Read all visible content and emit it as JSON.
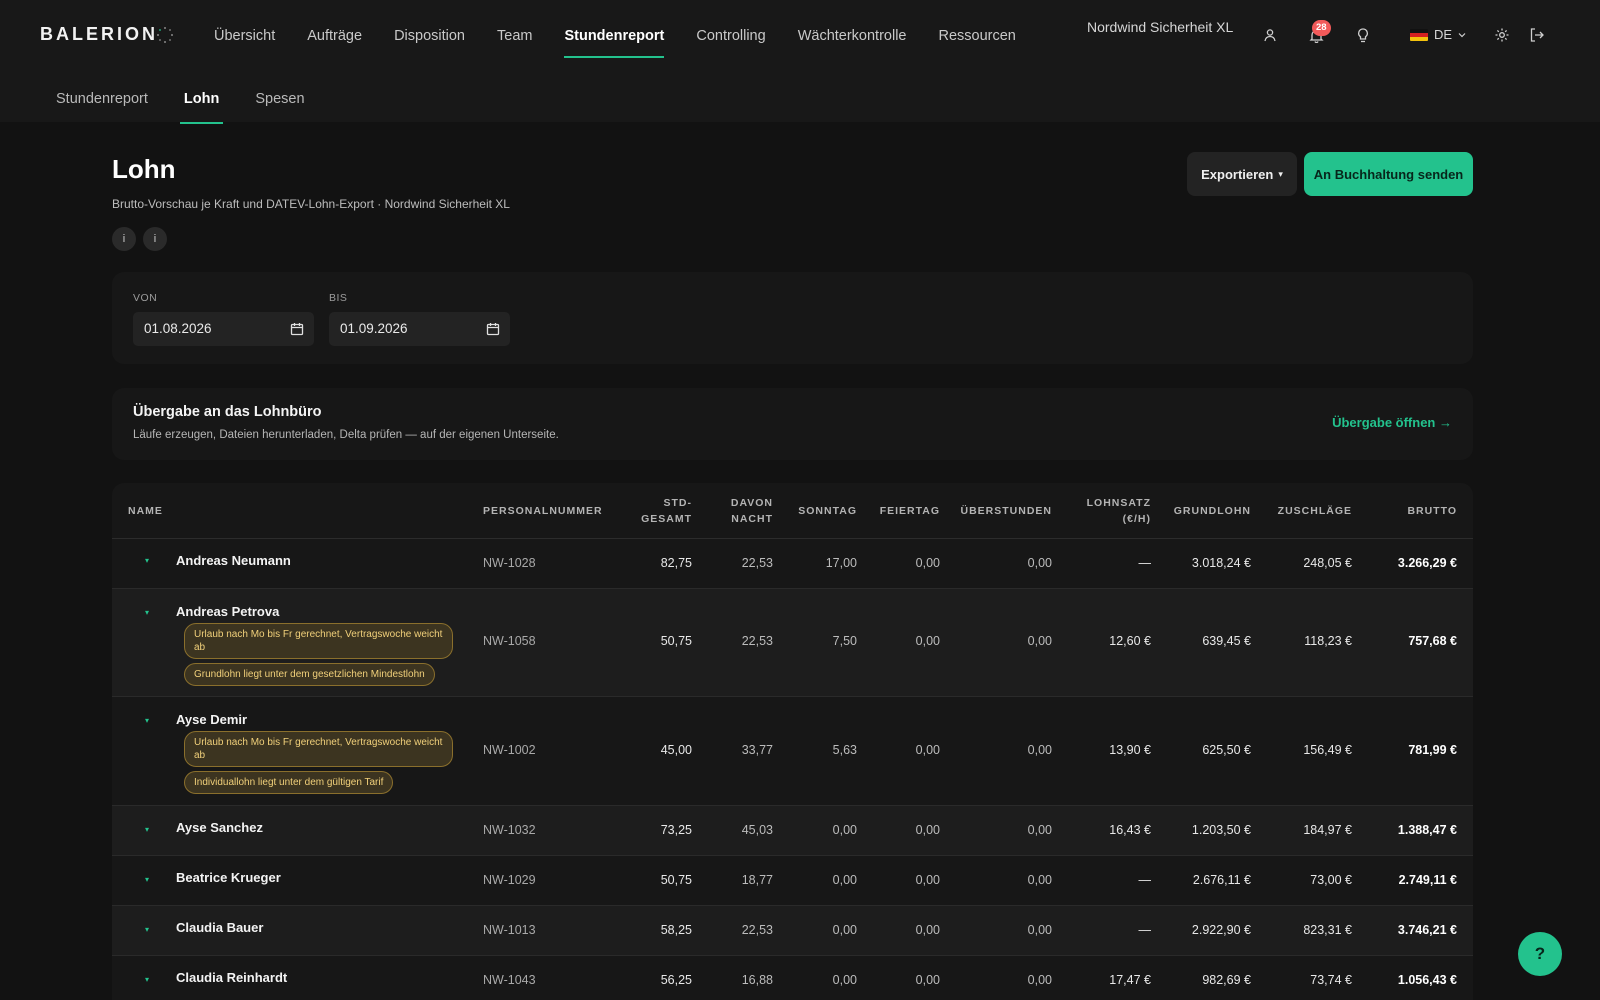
{
  "app": {
    "logo": "BALERION",
    "nav": [
      "Übersicht",
      "Aufträge",
      "Disposition",
      "Team",
      "Stundenreport",
      "Controlling",
      "Wächterkontrolle",
      "Ressourcen"
    ],
    "active_nav": "Stundenreport",
    "tenant": "Nordwind Sicherheit XL",
    "notification_count": "28",
    "language": "DE",
    "accent": "#23c28d"
  },
  "subnav": {
    "items": [
      "Stundenreport",
      "Lohn",
      "Spesen"
    ],
    "active": "Lohn"
  },
  "page": {
    "title": "Lohn",
    "subtitle": "Brutto-Vorschau je Kraft und DATEV-Lohn-Export · Nordwind Sicherheit XL",
    "info_1": "i",
    "info_2": "i",
    "export_label": "Exportieren",
    "export_caret": "▾",
    "send_label": "An Buchhaltung senden"
  },
  "filter": {
    "from_label": "VON",
    "from_value": "01.08.2026",
    "to_label": "BIS",
    "to_value": "01.09.2026"
  },
  "handover": {
    "title": "Übergabe an das Lohnbüro",
    "subtitle": "Läufe erzeugen, Dateien herunterladen, Delta prüfen — auf der eigenen Unterseite.",
    "link": "Übergabe öffnen →"
  },
  "table": {
    "headers": {
      "name": "NAME",
      "pnr": "PERSONALNUMMER",
      "std_1": "STD-",
      "std_2": "GESAMT",
      "nacht_1": "DAVON",
      "nacht_2": "NACHT",
      "sonntag": "SONNTAG",
      "feiertag": "FEIERTAG",
      "ueberstunden": "ÜBERSTUNDEN",
      "lohnsatz_1": "LOHNSATZ",
      "lohnsatz_2": "(€/H)",
      "grundlohn": "GRUNDLOHN",
      "zuschlaege": "ZUSCHLÄGE",
      "brutto": "BRUTTO"
    },
    "caret": "▾",
    "rows": [
      {
        "name": "Andreas Neumann",
        "pnr": "NW-1028",
        "std": "82,75",
        "nacht": "22,53",
        "sonntag": "17,00",
        "feiertag": "0,00",
        "ueber": "0,00",
        "satz": "—",
        "grund": "3.018,24 €",
        "zuschl": "248,05 €",
        "brutto": "3.266,29 €",
        "tags": []
      },
      {
        "name": "Andreas Petrova",
        "pnr": "NW-1058",
        "std": "50,75",
        "nacht": "22,53",
        "sonntag": "7,50",
        "feiertag": "0,00",
        "ueber": "0,00",
        "satz": "12,60 €",
        "grund": "639,45 €",
        "zuschl": "118,23 €",
        "brutto": "757,68 €",
        "tags": [
          "Urlaub nach Mo bis Fr gerechnet, Vertragswoche weicht ab",
          "Grundlohn liegt unter dem gesetzlichen Mindestlohn"
        ]
      },
      {
        "name": "Ayse Demir",
        "pnr": "NW-1002",
        "std": "45,00",
        "nacht": "33,77",
        "sonntag": "5,63",
        "feiertag": "0,00",
        "ueber": "0,00",
        "satz": "13,90 €",
        "grund": "625,50 €",
        "zuschl": "156,49 €",
        "brutto": "781,99 €",
        "tags": [
          "Urlaub nach Mo bis Fr gerechnet, Vertragswoche weicht ab",
          "Individuallohn liegt unter dem gültigen Tarif"
        ]
      },
      {
        "name": "Ayse Sanchez",
        "pnr": "NW-1032",
        "std": "73,25",
        "nacht": "45,03",
        "sonntag": "0,00",
        "feiertag": "0,00",
        "ueber": "0,00",
        "satz": "16,43 €",
        "grund": "1.203,50 €",
        "zuschl": "184,97 €",
        "brutto": "1.388,47 €",
        "tags": []
      },
      {
        "name": "Beatrice Krueger",
        "pnr": "NW-1029",
        "std": "50,75",
        "nacht": "18,77",
        "sonntag": "0,00",
        "feiertag": "0,00",
        "ueber": "0,00",
        "satz": "—",
        "grund": "2.676,11 €",
        "zuschl": "73,00 €",
        "brutto": "2.749,11 €",
        "tags": []
      },
      {
        "name": "Claudia Bauer",
        "pnr": "NW-1013",
        "std": "58,25",
        "nacht": "22,53",
        "sonntag": "0,00",
        "feiertag": "0,00",
        "ueber": "0,00",
        "satz": "—",
        "grund": "2.922,90 €",
        "zuschl": "823,31 €",
        "brutto": "3.746,21 €",
        "tags": []
      },
      {
        "name": "Claudia Reinhardt",
        "pnr": "NW-1043",
        "std": "56,25",
        "nacht": "16,88",
        "sonntag": "0,00",
        "feiertag": "0,00",
        "ueber": "0,00",
        "satz": "17,47 €",
        "grund": "982,69 €",
        "zuschl": "73,74 €",
        "brutto": "1.056,43 €",
        "tags": []
      }
    ]
  },
  "help_label": "?"
}
